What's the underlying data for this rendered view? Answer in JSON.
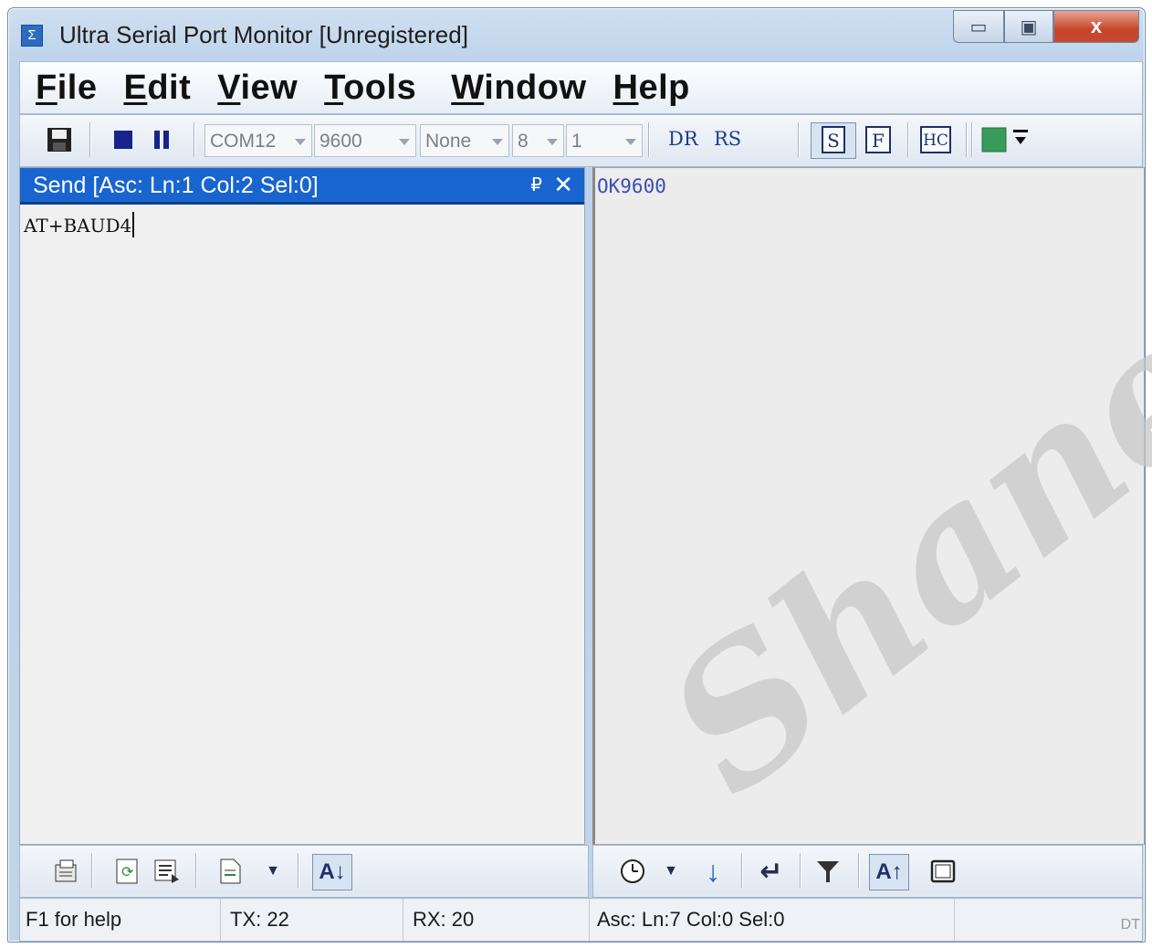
{
  "window": {
    "title": "Ultra Serial Port Monitor [Unregistered]",
    "app_icon": "Σ",
    "min": "▭",
    "max": "▣",
    "close": "x"
  },
  "menu": [
    {
      "first": "F",
      "rest": "ile"
    },
    {
      "first": "E",
      "rest": "dit"
    },
    {
      "first": "V",
      "rest": "iew"
    },
    {
      "first": "T",
      "rest": "ools"
    },
    {
      "first": "W",
      "rest": "indow"
    },
    {
      "first": "H",
      "rest": "elp"
    }
  ],
  "toolbar": {
    "port": "COM12",
    "baud": "9600",
    "parity": "None",
    "databits": "8",
    "stopbits": "1",
    "dr": "DR",
    "rs": "RS",
    "btn_s": "S",
    "btn_f": "F",
    "btn_hc": "HC",
    "color": "#3a9a5a"
  },
  "send_pane": {
    "header": "Send [Asc: Ln:1 Col:2 Sel:0]",
    "pin": "₽",
    "close": "✕",
    "text": "AT+BAUD4"
  },
  "receive_pane": {
    "text": "OK9600"
  },
  "watermark": "Shane",
  "status": {
    "help": "F1 for help",
    "tx": "TX: 22",
    "rx": "RX: 20",
    "position": "Asc: Ln:7  Col:0  Sel:0",
    "grip": "DT"
  }
}
